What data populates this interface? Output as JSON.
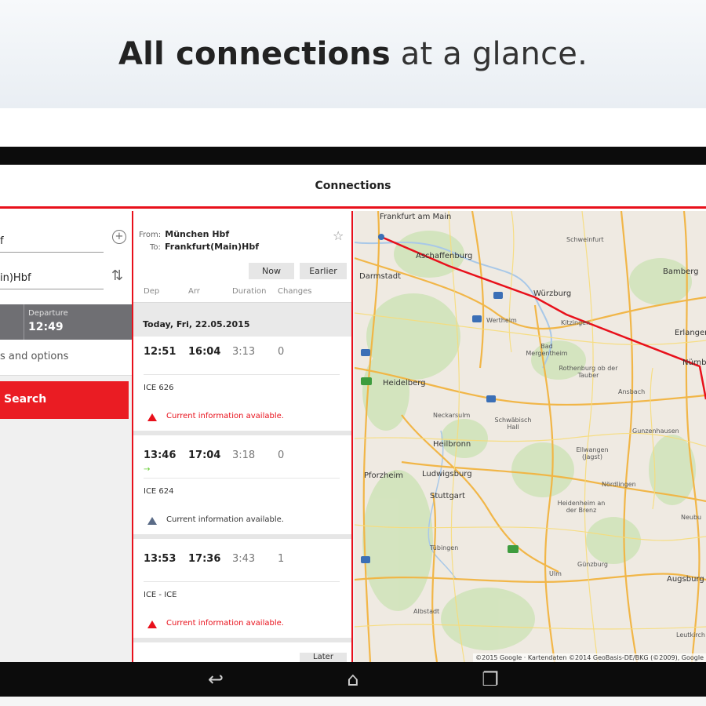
{
  "headline": {
    "strong": "All connections",
    "light": "at a glance."
  },
  "appbar": {
    "title": "Connections"
  },
  "search_form": {
    "from_value": "f",
    "to_value": "in)Hbf",
    "departure_label": "Departure",
    "departure_time": "12:49",
    "options_label": "s and options",
    "search_label": "Search",
    "icons": {
      "add": "add-via-icon",
      "swap": "swap-icon"
    }
  },
  "connections": {
    "from_label": "From:",
    "from_value": "München Hbf",
    "to_label": "To:",
    "to_value": "Frankfurt(Main)Hbf",
    "now_label": "Now",
    "earlier_label": "Earlier",
    "later_label": "Later",
    "columns": {
      "dep": "Dep",
      "arr": "Arr",
      "duration": "Duration",
      "changes": "Changes"
    },
    "date": "Today, Fri, 22.05.2015",
    "items": [
      {
        "dep": "12:51",
        "arr": "16:04",
        "duration": "3:13",
        "changes": "0",
        "train": "ICE 626",
        "info": "Current information available."
      },
      {
        "dep": "13:46",
        "arr": "17:04",
        "duration": "3:18",
        "changes": "0",
        "train": "ICE 624",
        "info": "Current information available."
      },
      {
        "dep": "13:53",
        "arr": "17:36",
        "duration": "3:43",
        "changes": "1",
        "train": "ICE - ICE",
        "info": "Current information available."
      }
    ]
  },
  "map": {
    "route_color": "#e8101b",
    "places": {
      "frankfurt": "Frankfurt am Main",
      "aschaffenburg": "Aschaffenburg",
      "schweinfurt": "Schweinfurt",
      "bamberg": "Bamberg",
      "darmstadt": "Darmstadt",
      "wurzburg": "Würzburg",
      "wertheim": "Wertheim",
      "kitzingen": "Kitzingen",
      "erlangen": "Erlangen",
      "badmergentheim": "Bad Mergentheim",
      "rothenburg": "Rothenburg ob der Tauber",
      "nurnberg": "Nürnb",
      "heidelberg": "Heidelberg",
      "ansbach": "Ansbach",
      "neckarsulm": "Neckarsulm",
      "schwabischhall": "Schwäbisch Hall",
      "heilbronn": "Heilbronn",
      "gunzenhausen": "Gunzenhausen",
      "ellwangen": "Ellwangen (Jagst)",
      "pforzheim": "Pforzheim",
      "ludwigsburg": "Ludwigsburg",
      "nordlingen": "Nördlingen",
      "stuttgart": "Stuttgart",
      "heidenheim": "Heidenheim an der Brenz",
      "tubingen": "Tübingen",
      "augsburg": "Augsburg",
      "gunzburg": "Günzburg",
      "ulm": "Ulm",
      "albstadt": "Albstadt",
      "neuburg": "Neubu",
      "leutkirch": "Leutkirch"
    },
    "copyright": "©2015 Google · Kartendaten ©2014 GeoBasis-DE/BKG (©2009), Google"
  },
  "navbar": {
    "back": "back-icon",
    "home": "home-icon",
    "recents": "recents-icon"
  }
}
